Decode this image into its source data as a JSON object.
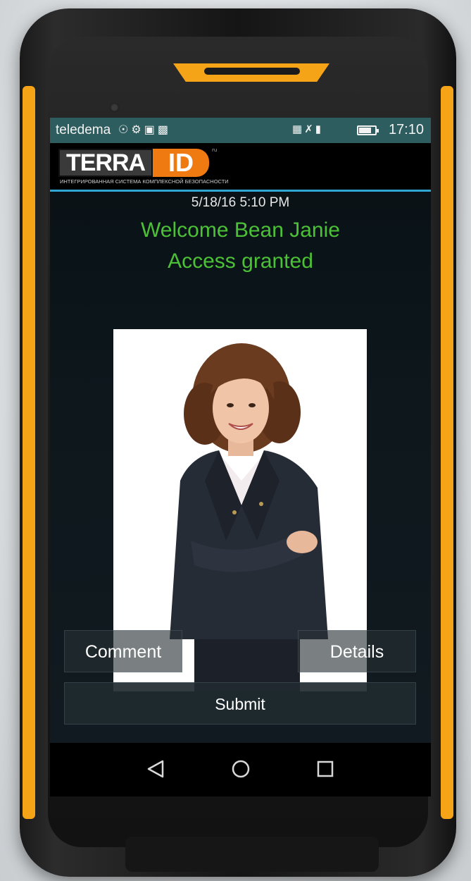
{
  "status_bar": {
    "carrier": "teledema",
    "left_icons": [
      "location-icon",
      "usb-icon",
      "image-icon",
      "screenshot-icon"
    ],
    "right_icons": [
      "nfc-icon",
      "mute-icon",
      "signal-icon",
      "battery-icon"
    ],
    "battery_level": 0.75,
    "time": "17:10"
  },
  "app": {
    "logo": {
      "terra": "TERRA",
      "id": "ID",
      "ru": "ru",
      "tagline": "ИНТЕГРИРОВАННАЯ СИСТЕМА КОМПЛЕКСНОЙ БЕЗОПАСНОСТИ"
    },
    "timestamp": "5/18/16 5:10 PM",
    "welcome": "Welcome Bean Janie",
    "access": "Access granted",
    "photo": "user-photo",
    "buttons": {
      "comment": "Comment",
      "details": "Details",
      "submit": "Submit"
    }
  },
  "nav": {
    "icons": [
      "back-icon",
      "home-icon",
      "recents-icon"
    ]
  },
  "colors": {
    "accent_green": "#4cc137",
    "status_bar": "#2d5d5e",
    "header_line": "#2fa6d4",
    "phone_orange": "#f5a417",
    "logo_orange": "#f07a12"
  }
}
